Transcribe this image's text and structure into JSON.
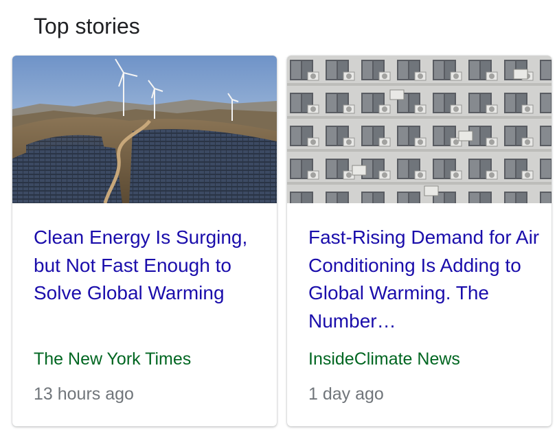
{
  "section": {
    "title": "Top stories"
  },
  "stories": [
    {
      "headline": "Clean Energy Is Surging, but Not Fast Enough to Solve Global Warming",
      "source": "The New York Times",
      "time": "13 hours ago",
      "image": "wind-turbines-and-solar-farm-photo"
    },
    {
      "headline": "Fast-Rising Demand for Air Conditioning Is Adding to Global Warming. The Number…",
      "source": "InsideClimate News",
      "time": "1 day ago",
      "image": "apartment-building-air-conditioners-photo"
    }
  ],
  "colors": {
    "headline": "#1a0dab",
    "source": "#006621",
    "time": "#70757a",
    "title": "#202124"
  }
}
